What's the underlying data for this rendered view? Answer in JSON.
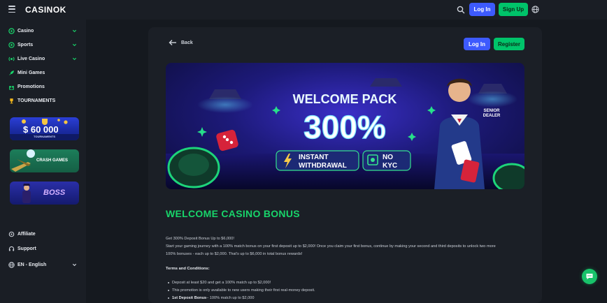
{
  "brand": {
    "logo_main": "CASIN",
    "logo_ok": "OK"
  },
  "header": {
    "login_label": "Log In",
    "signup_label": "Sign Up"
  },
  "sidebar": {
    "items": [
      {
        "label": "Casino",
        "icon": "casino-chip-icon",
        "has_chevron": true
      },
      {
        "label": "Sports",
        "icon": "soccer-ball-icon",
        "has_chevron": true
      },
      {
        "label": "Live Casino",
        "icon": "live-icon",
        "has_chevron": true
      },
      {
        "label": "Mini Games",
        "icon": "rocket-icon",
        "has_chevron": false
      },
      {
        "label": "Promotions",
        "icon": "gift-icon",
        "has_chevron": false
      },
      {
        "label": "TOURNAMENTS",
        "icon": "trophy-icon",
        "has_chevron": false
      }
    ],
    "promos": {
      "tournaments_amount": "$ 60 000",
      "tournaments_label": "TOURNAMENTS",
      "crash_label": "CRASH GAMES",
      "boss_label": "BOSS"
    },
    "footer": {
      "affiliate": "Affiliate",
      "support": "Support",
      "language": "EN - English"
    }
  },
  "panel": {
    "back_label": "Back",
    "login_label": "Log In",
    "register_label": "Register"
  },
  "banner": {
    "headline": "WELCOME PACK",
    "percent": "300%",
    "badge1": {
      "line1": "INSTANT",
      "line2": "WITHDRAWAL"
    },
    "badge2": {
      "line1": "NO",
      "line2": "KYC"
    },
    "dealer_line1": "SENIOR",
    "dealer_line2": "DEALER"
  },
  "content": {
    "title": "WELCOME CASINO BONUS",
    "intro": "Get 300% Deposit Bonus  Up to $6,000!",
    "body_line1": "Start your gaming journey with a 100% match bonus on your first deposit  up to $2,000! Once you claim your first bonus, continue by making your second and third deposits to unlock two more",
    "body_line2": "100% bonuses - each up to $2,000. That's up to $6,000 in total bonus rewards!",
    "terms_heading": "Terms and Conditions:",
    "terms": [
      {
        "bold": "",
        "text": "Deposit at least $20 and get a 100% match up to $2,000!"
      },
      {
        "bold": "",
        "text": "This promotion is only available to new users making their first real-money deposit."
      },
      {
        "bold": "1st Deposit Bonus",
        "text": " – 100% match up to $2,000"
      }
    ]
  },
  "colors": {
    "accent_green": "#18d46a",
    "primary_blue": "#3d5afe",
    "signup_green": "#00c46a",
    "background": "#15191f"
  }
}
